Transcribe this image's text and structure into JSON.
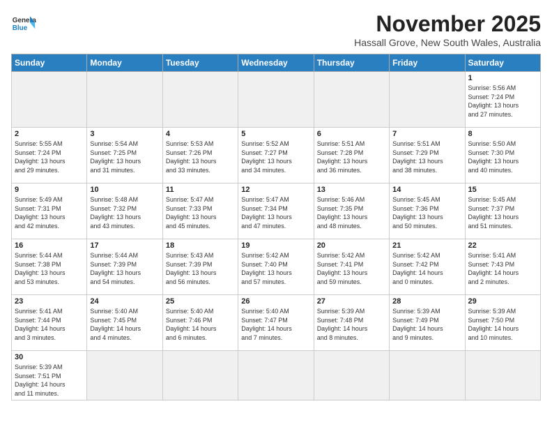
{
  "header": {
    "logo_general": "General",
    "logo_blue": "Blue",
    "month_title": "November 2025",
    "location": "Hassall Grove, New South Wales, Australia"
  },
  "days_of_week": [
    "Sunday",
    "Monday",
    "Tuesday",
    "Wednesday",
    "Thursday",
    "Friday",
    "Saturday"
  ],
  "weeks": [
    [
      {
        "day": "",
        "info": ""
      },
      {
        "day": "",
        "info": ""
      },
      {
        "day": "",
        "info": ""
      },
      {
        "day": "",
        "info": ""
      },
      {
        "day": "",
        "info": ""
      },
      {
        "day": "",
        "info": ""
      },
      {
        "day": "1",
        "info": "Sunrise: 5:56 AM\nSunset: 7:24 PM\nDaylight: 13 hours\nand 27 minutes."
      }
    ],
    [
      {
        "day": "2",
        "info": "Sunrise: 5:55 AM\nSunset: 7:24 PM\nDaylight: 13 hours\nand 29 minutes."
      },
      {
        "day": "3",
        "info": "Sunrise: 5:54 AM\nSunset: 7:25 PM\nDaylight: 13 hours\nand 31 minutes."
      },
      {
        "day": "4",
        "info": "Sunrise: 5:53 AM\nSunset: 7:26 PM\nDaylight: 13 hours\nand 33 minutes."
      },
      {
        "day": "5",
        "info": "Sunrise: 5:52 AM\nSunset: 7:27 PM\nDaylight: 13 hours\nand 34 minutes."
      },
      {
        "day": "6",
        "info": "Sunrise: 5:51 AM\nSunset: 7:28 PM\nDaylight: 13 hours\nand 36 minutes."
      },
      {
        "day": "7",
        "info": "Sunrise: 5:51 AM\nSunset: 7:29 PM\nDaylight: 13 hours\nand 38 minutes."
      },
      {
        "day": "8",
        "info": "Sunrise: 5:50 AM\nSunset: 7:30 PM\nDaylight: 13 hours\nand 40 minutes."
      }
    ],
    [
      {
        "day": "9",
        "info": "Sunrise: 5:49 AM\nSunset: 7:31 PM\nDaylight: 13 hours\nand 42 minutes."
      },
      {
        "day": "10",
        "info": "Sunrise: 5:48 AM\nSunset: 7:32 PM\nDaylight: 13 hours\nand 43 minutes."
      },
      {
        "day": "11",
        "info": "Sunrise: 5:47 AM\nSunset: 7:33 PM\nDaylight: 13 hours\nand 45 minutes."
      },
      {
        "day": "12",
        "info": "Sunrise: 5:47 AM\nSunset: 7:34 PM\nDaylight: 13 hours\nand 47 minutes."
      },
      {
        "day": "13",
        "info": "Sunrise: 5:46 AM\nSunset: 7:35 PM\nDaylight: 13 hours\nand 48 minutes."
      },
      {
        "day": "14",
        "info": "Sunrise: 5:45 AM\nSunset: 7:36 PM\nDaylight: 13 hours\nand 50 minutes."
      },
      {
        "day": "15",
        "info": "Sunrise: 5:45 AM\nSunset: 7:37 PM\nDaylight: 13 hours\nand 51 minutes."
      }
    ],
    [
      {
        "day": "16",
        "info": "Sunrise: 5:44 AM\nSunset: 7:38 PM\nDaylight: 13 hours\nand 53 minutes."
      },
      {
        "day": "17",
        "info": "Sunrise: 5:44 AM\nSunset: 7:39 PM\nDaylight: 13 hours\nand 54 minutes."
      },
      {
        "day": "18",
        "info": "Sunrise: 5:43 AM\nSunset: 7:39 PM\nDaylight: 13 hours\nand 56 minutes."
      },
      {
        "day": "19",
        "info": "Sunrise: 5:42 AM\nSunset: 7:40 PM\nDaylight: 13 hours\nand 57 minutes."
      },
      {
        "day": "20",
        "info": "Sunrise: 5:42 AM\nSunset: 7:41 PM\nDaylight: 13 hours\nand 59 minutes."
      },
      {
        "day": "21",
        "info": "Sunrise: 5:42 AM\nSunset: 7:42 PM\nDaylight: 14 hours\nand 0 minutes."
      },
      {
        "day": "22",
        "info": "Sunrise: 5:41 AM\nSunset: 7:43 PM\nDaylight: 14 hours\nand 2 minutes."
      }
    ],
    [
      {
        "day": "23",
        "info": "Sunrise: 5:41 AM\nSunset: 7:44 PM\nDaylight: 14 hours\nand 3 minutes."
      },
      {
        "day": "24",
        "info": "Sunrise: 5:40 AM\nSunset: 7:45 PM\nDaylight: 14 hours\nand 4 minutes."
      },
      {
        "day": "25",
        "info": "Sunrise: 5:40 AM\nSunset: 7:46 PM\nDaylight: 14 hours\nand 6 minutes."
      },
      {
        "day": "26",
        "info": "Sunrise: 5:40 AM\nSunset: 7:47 PM\nDaylight: 14 hours\nand 7 minutes."
      },
      {
        "day": "27",
        "info": "Sunrise: 5:39 AM\nSunset: 7:48 PM\nDaylight: 14 hours\nand 8 minutes."
      },
      {
        "day": "28",
        "info": "Sunrise: 5:39 AM\nSunset: 7:49 PM\nDaylight: 14 hours\nand 9 minutes."
      },
      {
        "day": "29",
        "info": "Sunrise: 5:39 AM\nSunset: 7:50 PM\nDaylight: 14 hours\nand 10 minutes."
      }
    ],
    [
      {
        "day": "30",
        "info": "Sunrise: 5:39 AM\nSunset: 7:51 PM\nDaylight: 14 hours\nand 11 minutes."
      },
      {
        "day": "",
        "info": ""
      },
      {
        "day": "",
        "info": ""
      },
      {
        "day": "",
        "info": ""
      },
      {
        "day": "",
        "info": ""
      },
      {
        "day": "",
        "info": ""
      },
      {
        "day": "",
        "info": ""
      }
    ]
  ]
}
